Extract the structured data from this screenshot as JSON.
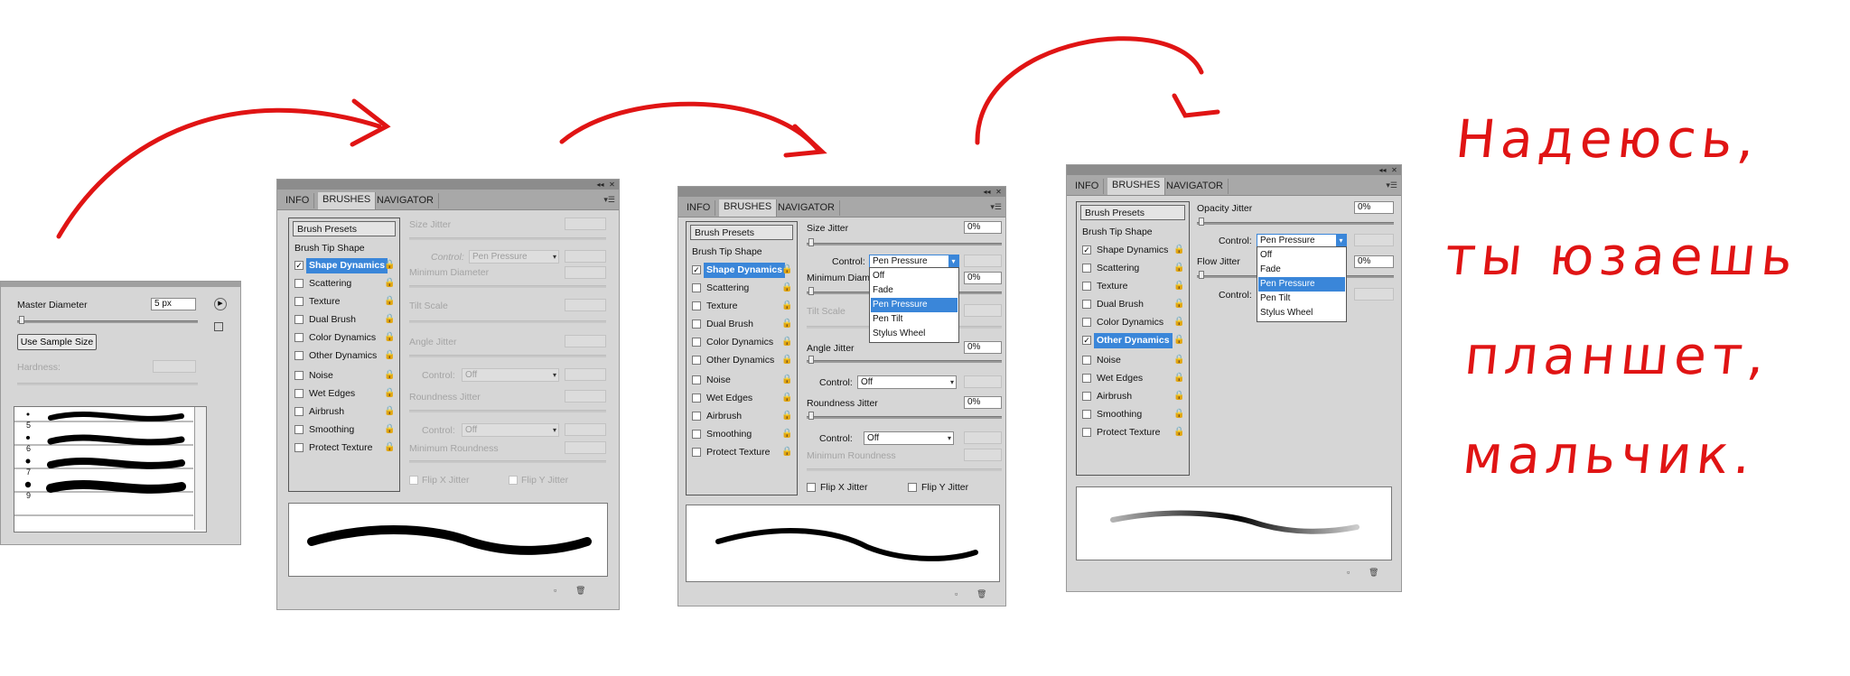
{
  "panel1": {
    "master_diameter_label": "Master Diameter",
    "master_diameter_value": "5 px",
    "use_sample_size": "Use Sample Size",
    "hardness_label": "Hardness:",
    "brush_sizes": [
      "5",
      "6",
      "7",
      "9"
    ]
  },
  "tabs": [
    "INFO",
    "BRUSHES",
    "NAVIGATOR"
  ],
  "left_list": {
    "brush_presets": "Brush Presets",
    "brush_tip_shape": "Brush Tip Shape",
    "items": [
      "Shape Dynamics",
      "Scattering",
      "Texture",
      "Dual Brush",
      "Color Dynamics",
      "Other Dynamics",
      "Noise",
      "Wet Edges",
      "Airbrush",
      "Smoothing",
      "Protect Texture"
    ]
  },
  "panel2": {
    "size_jitter": "Size Jitter",
    "control": "Control:",
    "control_value": "Pen Pressure",
    "minimum_diameter": "Minimum Diameter",
    "tilt_scale": "Tilt Scale",
    "angle_jitter": "Angle Jitter",
    "angle_control": "Off",
    "roundness_jitter": "Roundness Jitter",
    "roundness_control": "Off",
    "minimum_roundness": "Minimum Roundness",
    "flip_x": "Flip X Jitter",
    "flip_y": "Flip Y Jitter"
  },
  "panel3": {
    "size_jitter": "Size Jitter",
    "size_jitter_value": "0%",
    "control": "Control:",
    "control_value": "Pen Pressure",
    "minimum_diameter_partial": "Minimum Diam",
    "minimum_value": "0%",
    "tilt_scale": "Tilt Scale",
    "angle_jitter": "Angle Jitter",
    "angle_value": "0%",
    "angle_control": "Off",
    "roundness_jitter": "Roundness Jitter",
    "roundness_value": "0%",
    "roundness_control": "Off",
    "minimum_roundness": "Minimum Roundness",
    "flip_x": "Flip X Jitter",
    "flip_y": "Flip Y Jitter",
    "dropdown_options": [
      "Off",
      "Fade",
      "Pen Pressure",
      "Pen Tilt",
      "Stylus Wheel"
    ],
    "dropdown_selected": "Pen Pressure"
  },
  "panel4": {
    "opacity_jitter": "Opacity Jitter",
    "opacity_value": "0%",
    "control": "Control:",
    "control_value": "Pen Pressure",
    "flow_jitter": "Flow Jitter",
    "flow_value": "0%",
    "control2": "Control:",
    "dropdown_options": [
      "Off",
      "Fade",
      "Pen Pressure",
      "Pen Tilt",
      "Stylus Wheel"
    ],
    "dropdown_selected": "Pen Pressure"
  },
  "handwriting": {
    "line1": "Надеюсь,",
    "line2": "ты юзаешь",
    "line3": "планшет,",
    "line4": "мальчик."
  },
  "colors": {
    "accent_red": "#e01414",
    "selection_blue": "#3a86d9",
    "panel_gray": "#d6d6d6"
  }
}
